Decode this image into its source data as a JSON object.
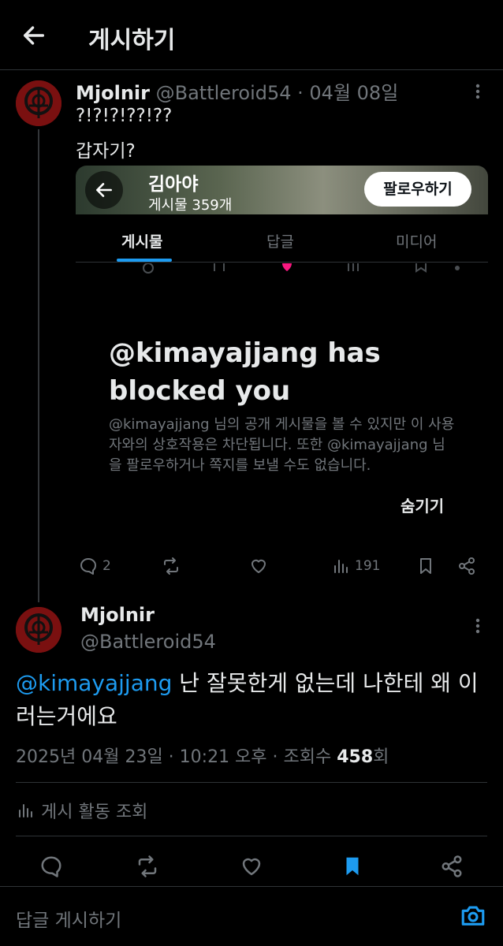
{
  "header": {
    "title": "게시하기"
  },
  "quoted": {
    "author_name": "Mjolnir",
    "author_handle": "@Battleroid54",
    "date": "· 04월 08일",
    "text_line1": "?!?!?!??!??",
    "text_line2": "갑자기?",
    "screenshot": {
      "profile_name": "김아야",
      "post_count": "게시물 359개",
      "follow_label": "팔로우하기",
      "tabs": [
        "게시물",
        "답글",
        "미디어"
      ]
    },
    "blocked": {
      "title": "@kimayajjang has blocked you",
      "description": "@kimayajjang 님의 공개 게시물을 볼 수 있지만 이 사용자와의 상호작용은 차단됩니다. 또한 @kimayajjang 님을 팔로우하거나 쪽지를 보낼 수도 없습니다.",
      "hide_label": "숨기기"
    },
    "actions": {
      "replies": "2",
      "views": "191"
    }
  },
  "main": {
    "author_name": "Mjolnir",
    "author_handle": "@Battleroid54",
    "mention": "@kimayajjang",
    "body": " 난 잘못한게 없는데 나한테 왜 이러는거에요",
    "timestamp": "2025년 04월 23일 · 10:21 오후 · 조회수 ",
    "views": "458",
    "views_suffix": "회",
    "activity_label": "게시 활동 조회"
  },
  "reply": {
    "placeholder": "답글 게시하기"
  },
  "colors": {
    "accent": "#1d9bf0",
    "muted": "#71767b",
    "background": "#000000",
    "like": "#f91880"
  }
}
